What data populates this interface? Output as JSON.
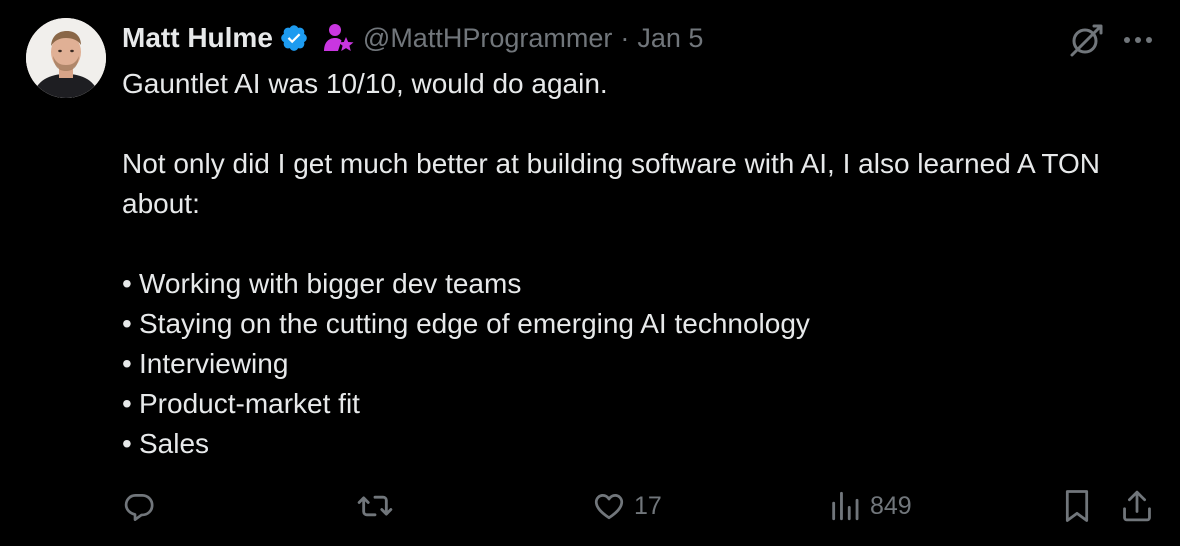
{
  "tweet": {
    "author": {
      "display_name": "Matt Hulme",
      "handle": "@MattHProgrammer",
      "verified": true,
      "verified_color": "#1d9bf0",
      "affiliate_badge_color": "#c936e0"
    },
    "separator": "·",
    "date": "Jan 5",
    "body": {
      "line1": "Gauntlet AI was 10/10, would do again.",
      "line2": "Not only did I get much better at building software with AI, I also learned A TON about:",
      "bullet_char": "•",
      "bullets": [
        "Working with bigger dev teams",
        "Staying on the cutting edge of emerging AI technology",
        "Interviewing",
        "Product-market fit",
        "Sales"
      ]
    },
    "actions": {
      "reply_count": "",
      "retweet_count": "",
      "like_count": "17",
      "views_count": "849"
    },
    "icons": {
      "reply": "reply-icon",
      "retweet": "retweet-icon",
      "like": "heart-icon",
      "views": "views-icon",
      "bookmark": "bookmark-icon",
      "share": "share-icon",
      "grok": "grok-icon",
      "more": "more-icon"
    },
    "colors": {
      "background": "#000000",
      "text": "#e7e9ea",
      "muted": "#71767b"
    }
  }
}
